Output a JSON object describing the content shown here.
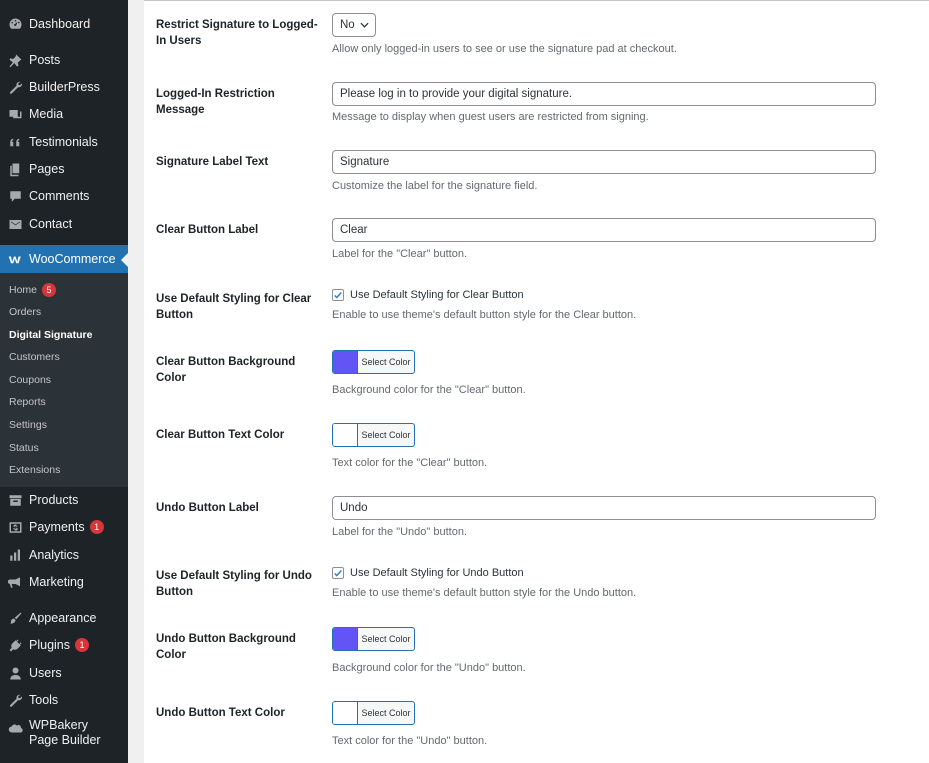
{
  "sidebar": {
    "top_items": [
      {
        "label": "Dashboard",
        "icon": "dashboard-icon"
      },
      {
        "label": "Posts",
        "icon": "pin-icon"
      },
      {
        "label": "BuilderPress",
        "icon": "wrench-icon"
      },
      {
        "label": "Media",
        "icon": "media-icon"
      },
      {
        "label": "Testimonials",
        "icon": "quote-icon"
      },
      {
        "label": "Pages",
        "icon": "pages-icon"
      },
      {
        "label": "Comments",
        "icon": "comment-icon"
      },
      {
        "label": "Contact",
        "icon": "mail-icon"
      }
    ],
    "woocommerce": {
      "label": "WooCommerce",
      "icon": "woo-icon"
    },
    "submenu": [
      {
        "label": "Home",
        "badge": "5"
      },
      {
        "label": "Orders",
        "badge": ""
      },
      {
        "label": "Digital Signature",
        "badge": ""
      },
      {
        "label": "Customers",
        "badge": ""
      },
      {
        "label": "Coupons",
        "badge": ""
      },
      {
        "label": "Reports",
        "badge": ""
      },
      {
        "label": "Settings",
        "badge": ""
      },
      {
        "label": "Status",
        "badge": ""
      },
      {
        "label": "Extensions",
        "badge": ""
      }
    ],
    "bottom_items": [
      {
        "label": "Products",
        "badge": "",
        "icon": "archive-icon"
      },
      {
        "label": "Payments",
        "badge": "1",
        "icon": "payments-icon"
      },
      {
        "label": "Analytics",
        "badge": "",
        "icon": "bar-chart-icon"
      },
      {
        "label": "Marketing",
        "badge": "",
        "icon": "megaphone-icon"
      },
      {
        "label": "Appearance",
        "badge": "",
        "icon": "brush-icon"
      },
      {
        "label": "Plugins",
        "badge": "1",
        "icon": "plugin-icon"
      },
      {
        "label": "Users",
        "badge": "",
        "icon": "user-icon"
      },
      {
        "label": "Tools",
        "badge": "",
        "icon": "tools-icon"
      },
      {
        "label": "WPBakery Page Builder",
        "badge": "",
        "icon": "wpbakery-icon"
      }
    ]
  },
  "settings": {
    "restrict": {
      "label": "Restrict Signature to Logged-In Users",
      "value": "No",
      "desc": "Allow only logged-in users to see or use the signature pad at checkout."
    },
    "restriction_message": {
      "label": "Logged-In Restriction Message",
      "value": "Please log in to provide your digital signature.",
      "desc": "Message to display when guest users are restricted from signing."
    },
    "signature_label": {
      "label": "Signature Label Text",
      "value": "Signature",
      "desc": "Customize the label for the signature field."
    },
    "clear_label": {
      "label": "Clear Button Label",
      "value": "Clear",
      "desc": "Label for the \"Clear\" button."
    },
    "clear_default": {
      "label": "Use Default Styling for Clear Button",
      "checkbox_text": "Use Default Styling for Clear Button",
      "checked": true,
      "desc": "Enable to use theme's default button style for the Clear button."
    },
    "clear_bg": {
      "label": "Clear Button Background Color",
      "button_text": "Select Color",
      "color": "#6254f5",
      "desc": "Background color for the \"Clear\" button."
    },
    "clear_text_color": {
      "label": "Clear Button Text Color",
      "button_text": "Select Color",
      "color": "#ffffff",
      "desc": "Text color for the \"Clear\" button."
    },
    "undo_label": {
      "label": "Undo Button Label",
      "value": "Undo",
      "desc": "Label for the \"Undo\" button."
    },
    "undo_default": {
      "label": "Use Default Styling for Undo Button",
      "checkbox_text": "Use Default Styling for Undo Button",
      "checked": true,
      "desc": "Enable to use theme's default button style for the Undo button."
    },
    "undo_bg": {
      "label": "Undo Button Background Color",
      "button_text": "Select Color",
      "color": "#6254f5",
      "desc": "Background color for the \"Undo\" button."
    },
    "undo_text_color": {
      "label": "Undo Button Text Color",
      "button_text": "Select Color",
      "color": "#ffffff",
      "desc": "Text color for the \"Undo\" button."
    }
  },
  "colors": {
    "sidebar_bg": "#1d2327",
    "submenu_bg": "#2c3338",
    "accent": "#2271b1",
    "badge": "#d63638",
    "checkmark": "#3582c4"
  }
}
